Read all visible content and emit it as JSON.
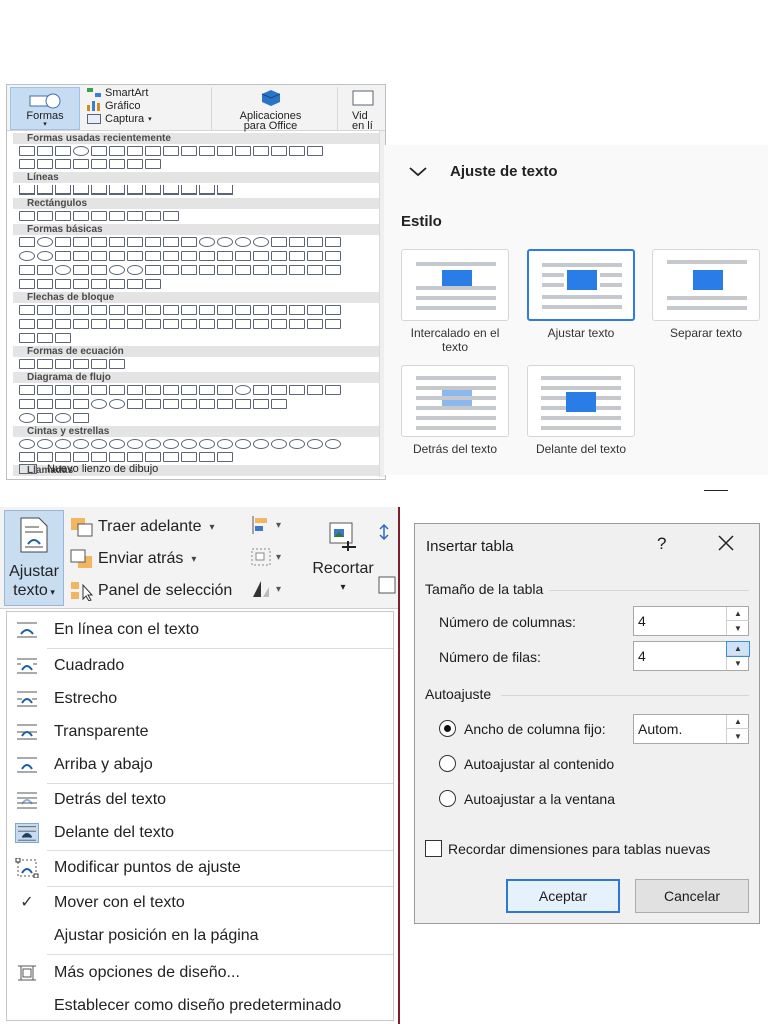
{
  "shapes_panel": {
    "ribbon": {
      "formas_label": "Formas",
      "smartart_label": "SmartArt",
      "grafico_label": "Gráfico",
      "captura_label": "Captura",
      "apps_line1": "Aplicaciones",
      "apps_line2": "para Office",
      "video_line1": "Vid",
      "video_line2": "en lí"
    },
    "categories": [
      "Formas usadas recientemente",
      "Líneas",
      "Rectángulos",
      "Formas básicas",
      "Flechas de bloque",
      "Formas de ecuación",
      "Diagrama de flujo",
      "Cintas y estrellas",
      "Llamadas"
    ],
    "new_canvas_label": "Nuevo lienzo de dibujo"
  },
  "wrap_panel": {
    "header_title": "Ajuste de texto",
    "section_label": "Estilo",
    "options": [
      {
        "label": "Intercalado en el texto",
        "selected": false
      },
      {
        "label": "Ajustar texto",
        "selected": true
      },
      {
        "label": "Separar texto",
        "selected": false
      },
      {
        "label": "Detrás del texto",
        "selected": false
      },
      {
        "label": "Delante del texto",
        "selected": false
      }
    ],
    "accent_color": "#2a7de6"
  },
  "wrap_menu": {
    "button_line1": "Ajustar",
    "button_line2": "texto",
    "ribbon_items": {
      "traer_adelante": "Traer adelante",
      "enviar_atras": "Enviar atrás",
      "panel_seleccion": "Panel de selección",
      "recortar": "Recortar"
    },
    "items": [
      {
        "label": "En línea con el texto"
      },
      {
        "label": "Cuadrado"
      },
      {
        "label": "Estrecho"
      },
      {
        "label": "Transparente"
      },
      {
        "label": "Arriba y abajo"
      },
      {
        "label": "Detrás del texto"
      },
      {
        "label": "Delante del texto",
        "checked_style": true
      },
      {
        "label": "Modificar puntos de ajuste"
      },
      {
        "label": "Mover con el texto",
        "checked": true
      },
      {
        "label": "Ajustar posición en la página"
      },
      {
        "label": "Más opciones de diseño..."
      },
      {
        "label": "Establecer como diseño predeterminado"
      }
    ]
  },
  "dialog": {
    "title": "Insertar tabla",
    "help_glyph": "?",
    "group_size": "Tamaño de la tabla",
    "columns_label": "Número de columnas:",
    "columns_value": "4",
    "rows_label": "Número de filas:",
    "rows_value": "4",
    "group_autofit": "Autoajuste",
    "radio_fixed": "Ancho de columna fijo:",
    "fixed_value": "Autom.",
    "radio_contents": "Autoajustar al contenido",
    "radio_window": "Autoajustar a la ventana",
    "remember_label": "Recordar dimensiones para tablas nuevas",
    "ok_label": "Aceptar",
    "cancel_label": "Cancelar",
    "selected_radio": "fixed"
  }
}
